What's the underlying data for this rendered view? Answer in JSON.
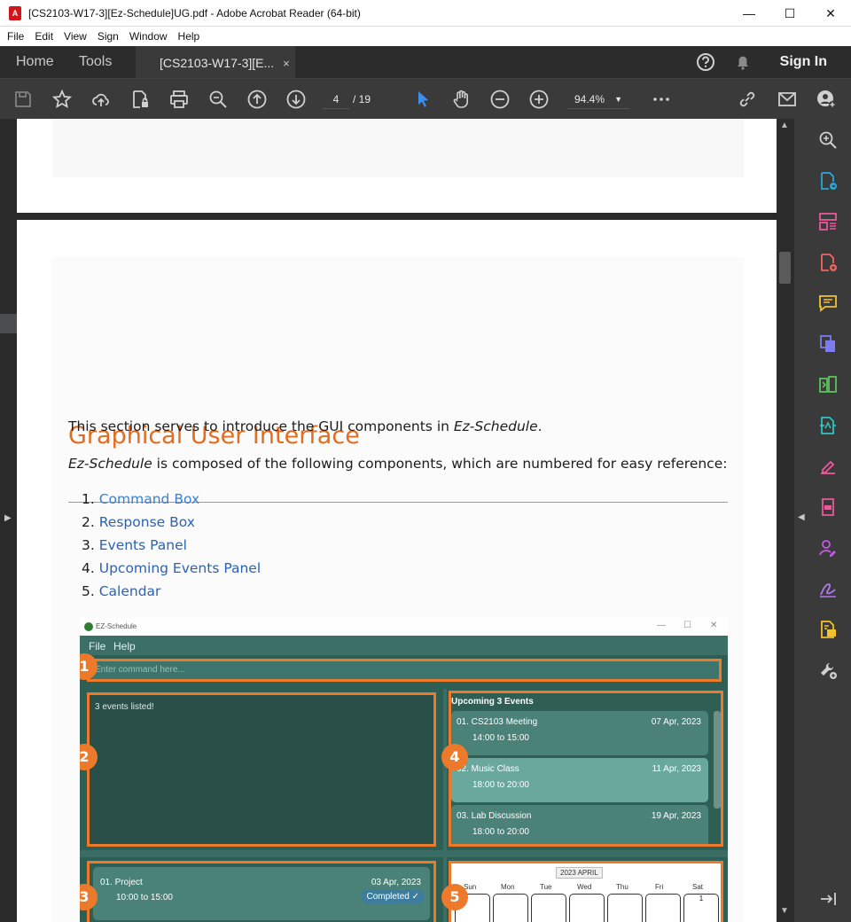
{
  "window": {
    "title": "[CS2103-W17-3][Ez-Schedule]UG.pdf - Adobe Acrobat Reader (64-bit)",
    "minimize": "—",
    "maximize": "☐",
    "close": "✕"
  },
  "menu": [
    "File",
    "Edit",
    "View",
    "Sign",
    "Window",
    "Help"
  ],
  "tabs": {
    "home": "Home",
    "tools": "Tools",
    "doc": "[CS2103-W17-3][E...",
    "close": "×",
    "signin": "Sign In"
  },
  "toolbar": {
    "page_current": "4",
    "page_total": "/ 19",
    "zoom": "94.4%"
  },
  "document": {
    "heading": "Graphical User Interface",
    "para1_pre": "This section serves to introduce the GUI components in ",
    "para1_em": "Ez-Schedule",
    "para1_post": ".",
    "para2_em": "Ez-Schedule",
    "para2_post": " is composed of the following components, which are numbered for easy reference:",
    "list": [
      {
        "num": "1.",
        "label": "Command Box"
      },
      {
        "num": "2.",
        "label": "Response Box"
      },
      {
        "num": "3.",
        "label": "Events Panel"
      },
      {
        "num": "4.",
        "label": "Upcoming Events Panel"
      },
      {
        "num": "5.",
        "label": "Calendar"
      }
    ]
  },
  "app_screenshot": {
    "window_title": "EZ-Schedule",
    "menu": [
      "File",
      "Help"
    ],
    "command_placeholder": "Enter command here...",
    "response": "3 events listed!",
    "upcoming_header": "Upcoming 3 Events",
    "upcoming": [
      {
        "l1": "01.  CS2103 Meeting",
        "l2": "14:00 to 15:00",
        "date": "07 Apr, 2023"
      },
      {
        "l1": "02.  Music Class",
        "l2": "18:00 to 20:00",
        "date": "11 Apr, 2023"
      },
      {
        "l1": "03.  Lab Discussion",
        "l2": "18:00 to 20:00",
        "date": "19 Apr, 2023"
      }
    ],
    "event": {
      "l1": "01.   Project",
      "l2": "10:00 to 15:00",
      "date": "03 Apr, 2023",
      "status": "Completed ✓"
    },
    "calendar_month": "2023 APRIL",
    "days": [
      "Sun",
      "Mon",
      "Tue",
      "Wed",
      "Thu",
      "Fri",
      "Sat"
    ],
    "first_day": "1",
    "badges": [
      "1",
      "2",
      "3",
      "4",
      "5"
    ]
  },
  "colors": {
    "heading": "#e36c1e",
    "link": "#2b62b5",
    "accent_orange": "#ec7a2a",
    "app_bg": "#2f5e55"
  }
}
